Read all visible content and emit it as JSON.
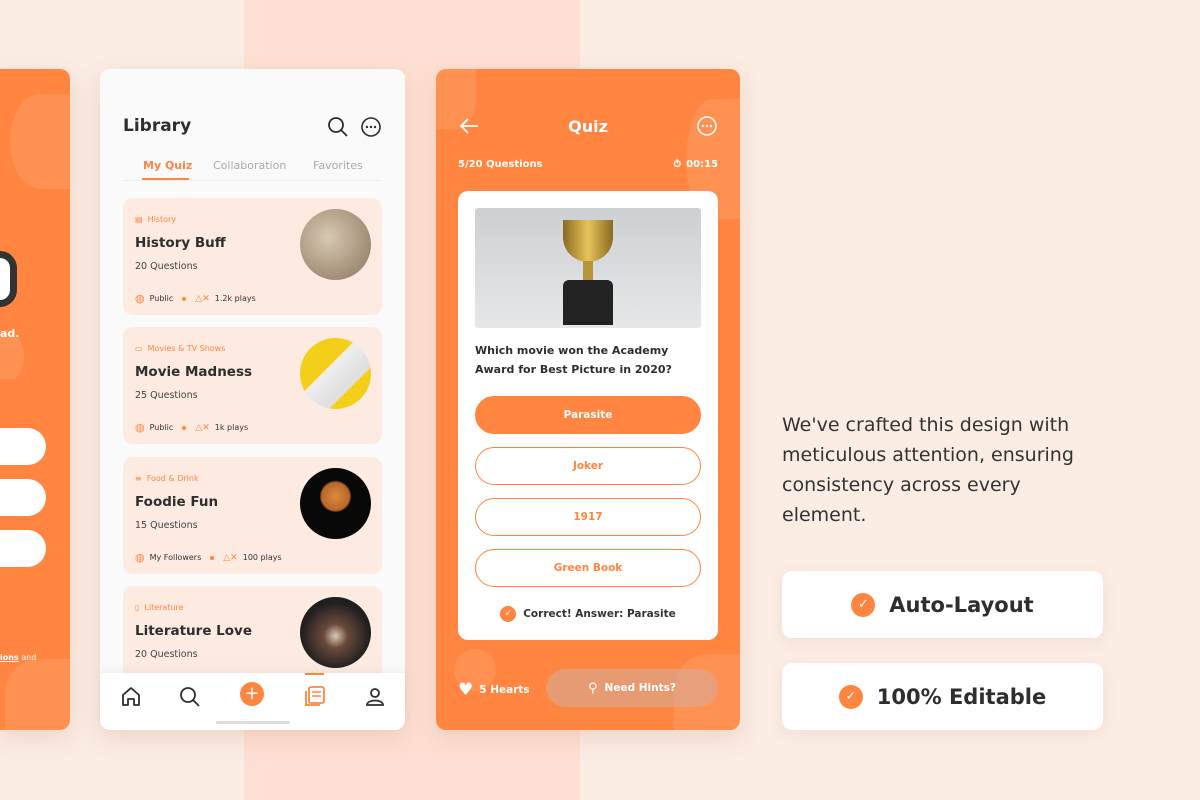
{
  "colors": {
    "accent": "#ff8540",
    "background": "#fbece4",
    "card": "#fdeae0"
  },
  "left_screen": {
    "fragment_text": "ad.",
    "terms_bold": "ions",
    "terms_rest": " and"
  },
  "library": {
    "title": "Library",
    "icons": [
      "search-icon",
      "more-icon"
    ],
    "tabs": [
      {
        "label": "My Quiz",
        "active": true
      },
      {
        "label": "Collaboration",
        "active": false
      },
      {
        "label": "Favorites",
        "active": false
      }
    ],
    "quizzes": [
      {
        "category": "History",
        "category_icon": "scroll-icon",
        "title": "History Buff",
        "questions": "20 Questions",
        "visibility": "Public",
        "plays": "1.2k plays"
      },
      {
        "category": "Movies & TV Shows",
        "category_icon": "clapper-icon",
        "title": "Movie Madness",
        "questions": "25 Questions",
        "visibility": "Public",
        "plays": "1k plays"
      },
      {
        "category": "Food & Drink",
        "category_icon": "food-icon",
        "title": "Foodie Fun",
        "questions": "15 Questions",
        "visibility": "My Followers",
        "plays": "100 plays"
      },
      {
        "category": "Literature",
        "category_icon": "book-icon",
        "title": "Literature Love",
        "questions": "20 Questions"
      }
    ],
    "nav": [
      "home",
      "search",
      "add",
      "library",
      "profile"
    ],
    "nav_active": "library"
  },
  "quiz": {
    "title": "Quiz",
    "progress": "5/20 Questions",
    "timer": "00:15",
    "question": "Which movie won the Academy Award for Best Picture in 2020?",
    "options": [
      {
        "label": "Parasite",
        "selected": true
      },
      {
        "label": "Joker",
        "selected": false
      },
      {
        "label": "1917",
        "selected": false
      },
      {
        "label": "Green Book",
        "selected": false
      }
    ],
    "feedback": "Correct! Answer: Parasite",
    "hearts": "5 Hearts",
    "hint_button": "Need Hints?"
  },
  "promo": {
    "text": "We've crafted this design with meticulous attention, ensuring consistency across every element.",
    "features": [
      "Auto-Layout",
      "100% Editable"
    ]
  }
}
